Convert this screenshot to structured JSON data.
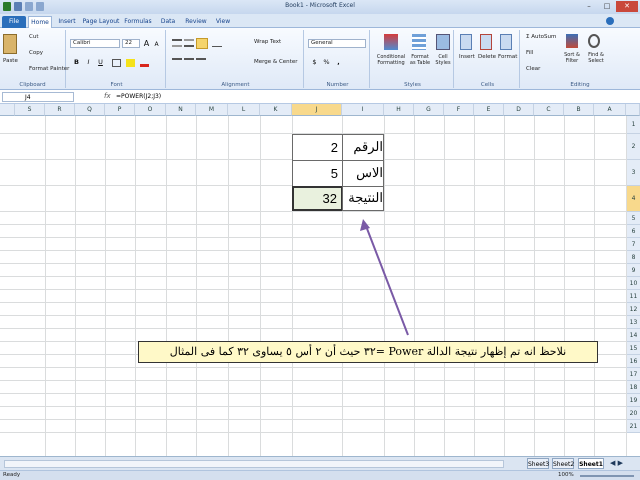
{
  "window": {
    "title": "Book1 - Microsoft Excel",
    "min": "–",
    "max": "□",
    "close": "✕"
  },
  "tabs": [
    "File",
    "Home",
    "Insert",
    "Page Layout",
    "Formulas",
    "Data",
    "Review",
    "View"
  ],
  "ribbon": {
    "clipboard": {
      "label": "Clipboard",
      "paste": "Paste",
      "cut": "Cut",
      "copy": "Copy",
      "format_painter": "Format Painter"
    },
    "font": {
      "label": "Font",
      "name": "Calibri",
      "size": "22",
      "bold": "B",
      "italic": "I",
      "underline": "U",
      "grow": "A",
      "shrink": "A"
    },
    "alignment": {
      "label": "Alignment",
      "wrap": "Wrap Text",
      "merge": "Merge & Center"
    },
    "number": {
      "label": "Number",
      "format": "General",
      "currency": "$",
      "percent": "%",
      "comma": ","
    },
    "styles": {
      "label": "Styles",
      "conditional": "Conditional Formatting",
      "table": "Format as Table",
      "cell": "Cell Styles"
    },
    "cells": {
      "label": "Cells",
      "insert": "Insert",
      "delete": "Delete",
      "format": "Format"
    },
    "editing": {
      "label": "Editing",
      "autosum": "AutoSum",
      "fill": "Fill",
      "clear": "Clear",
      "sort": "Sort & Filter",
      "find": "Find & Select"
    }
  },
  "formula_bar": {
    "name_box": "J4",
    "fx": "fx",
    "formula": "=POWER(J2;J3)"
  },
  "columns": [
    "S",
    "R",
    "Q",
    "P",
    "O",
    "N",
    "M",
    "L",
    "K",
    "J",
    "I",
    "H",
    "G",
    "F",
    "E",
    "D",
    "C",
    "B",
    "A"
  ],
  "rows": [
    "1",
    "2",
    "3",
    "4",
    "5",
    "6",
    "7",
    "8",
    "9",
    "10",
    "11",
    "12",
    "13",
    "14",
    "15",
    "16",
    "17",
    "18",
    "19",
    "20",
    "21"
  ],
  "cells": {
    "j2": "2",
    "i2": "الرقم",
    "j3": "5",
    "i3": "الاس",
    "j4": "32",
    "i4": "النتيجة"
  },
  "note": "نلاحظ انه تم إظهار نتيجة الدالة Power =٣٢ حيث أن ٢ أس ٥ يساوى ٣٢ كما فى المثال",
  "sheets": [
    "Sheet3",
    "Sheet2",
    "Sheet1"
  ],
  "status": {
    "mode": "Ready",
    "zoom": "100%"
  },
  "colors": {
    "accent": "#2a6ebb",
    "arrow": "#7a5aa6",
    "note_bg": "#fff9c8",
    "selected_cell": "#e9f1de"
  }
}
